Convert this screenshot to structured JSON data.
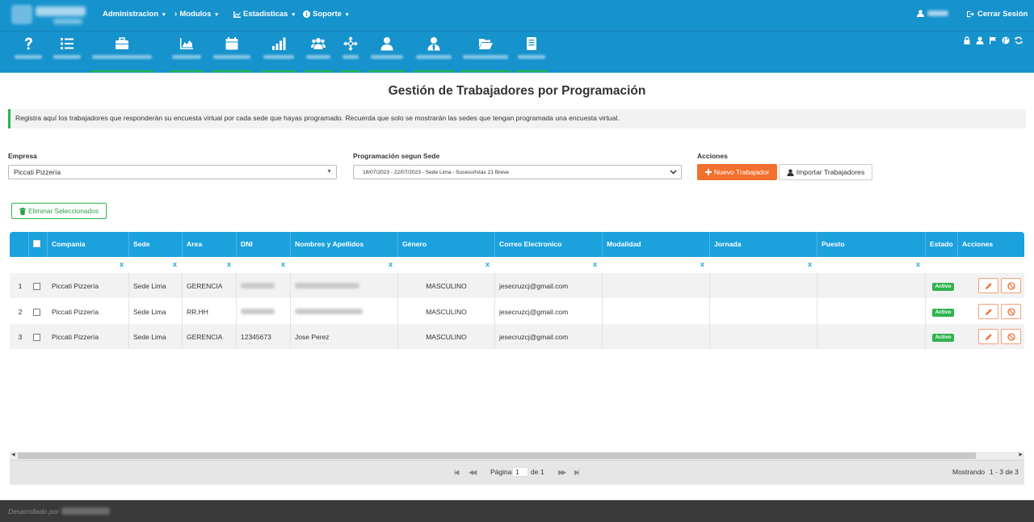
{
  "topnav": {
    "menus": [
      {
        "label": "Administracion",
        "icon": "none"
      },
      {
        "label": "Modulos",
        "icon": "chevron-right-icon"
      },
      {
        "label": "Estadisticas",
        "icon": "chart-icon"
      },
      {
        "label": "Soporte",
        "icon": "info-circle-icon"
      }
    ],
    "logout_label": "Cerrar Sesión"
  },
  "toolbar": {
    "icons": [
      "question-icon",
      "list-icon",
      "briefcase-icon",
      "area-chart-icon",
      "calendar-icon",
      "signal-bars-icon",
      "group-icon",
      "move-icon",
      "user-icon",
      "user-tie-icon",
      "folder-open-icon",
      "book-icon"
    ],
    "right_icons": [
      "lock-icon",
      "user-small-icon",
      "flag-icon",
      "globe-icon",
      "refresh-icon"
    ]
  },
  "page": {
    "title": "Gestión de Trabajadores por Programación",
    "alert": "Registra aquí los trabajadores que responderán su encuesta virtual por cada sede que hayas programado. Recuerda que solo se mostrarán las sedes que tengan programada una encuesta virtual."
  },
  "filters": {
    "empresa_label": "Empresa",
    "empresa_value": "Piccati Pizzería",
    "programacion_label": "Programación segun Sede",
    "programacion_value": "18/07/2023 - 22/07/2023 - Sede Lima - Suseso/Istas 21 Breve",
    "acciones_label": "Acciones",
    "nuevo_label": "Nuevo Trabajador",
    "importar_label": "Importar Trabajadores",
    "eliminar_label": "Eliminar Seleccionados"
  },
  "grid": {
    "columns": [
      "Compania",
      "Sede",
      "Area",
      "DNI",
      "Nombres y Apellidos",
      "Género",
      "Correo Electronico",
      "Modalidad",
      "Jornada",
      "Puesto",
      "Estado",
      "Acciones"
    ],
    "filter_clear": "x",
    "rows": [
      {
        "num": "1",
        "compania": "Piccati Pizzería",
        "sede": "Sede Lima",
        "area": "GERENCIA",
        "dni": "",
        "nombre": "",
        "genero": "MASCULINO",
        "correo": "jesecruzcj@gmail.com",
        "modalidad": "",
        "jornada": "",
        "puesto": "",
        "estado": "Activo"
      },
      {
        "num": "2",
        "compania": "Piccati Pizzería",
        "sede": "Sede Lima",
        "area": "RR.HH",
        "dni": "",
        "nombre": "",
        "genero": "MASCULINO",
        "correo": "jesecruzcj@gmail.com",
        "modalidad": "",
        "jornada": "",
        "puesto": "",
        "estado": "Activo"
      },
      {
        "num": "3",
        "compania": "Piccati Pizzería",
        "sede": "Sede Lima",
        "area": "GERENCIA",
        "dni": "12345673",
        "nombre": "Jose Perez",
        "genero": "MASCULINO",
        "correo": "jesecruzcj@gmail.com",
        "modalidad": "",
        "jornada": "",
        "puesto": "",
        "estado": "Activo"
      }
    ]
  },
  "pager": {
    "page_label": "Página",
    "page_value": "1",
    "of_label": "de 1",
    "showing": "Mostrando",
    "range": "1 - 3 de 3"
  },
  "footer": {
    "text": "Desarrollado por"
  },
  "colors": {
    "nav": "#1692cc",
    "grid_header": "#1ba1dc",
    "orange": "#f26f2e",
    "green": "#2fb34e",
    "footer": "#3a3a3a"
  }
}
